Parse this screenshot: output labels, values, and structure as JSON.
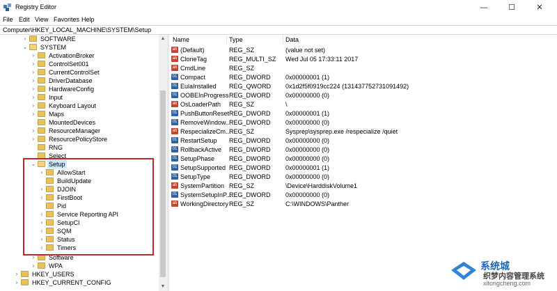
{
  "window": {
    "title": "Registry Editor",
    "controls": {
      "minimize": "—",
      "maximize": "☐",
      "close": "✕"
    }
  },
  "menu": [
    "File",
    "Edit",
    "View",
    "Favorites",
    "Help"
  ],
  "address": "Computer\\HKEY_LOCAL_MACHINE\\SYSTEM\\Setup",
  "tree": [
    {
      "label": "SOFTWARE",
      "expander": "›"
    },
    {
      "label": "SYSTEM",
      "expander": "⌄"
    },
    {
      "label": "ActivationBroker",
      "expander": "›"
    },
    {
      "label": "ControlSet001",
      "expander": "›"
    },
    {
      "label": "CurrentControlSet",
      "expander": "›"
    },
    {
      "label": "DriverDatabase",
      "expander": "›"
    },
    {
      "label": "HardwareConfig",
      "expander": "›"
    },
    {
      "label": "Input",
      "expander": "›"
    },
    {
      "label": "Keyboard Layout",
      "expander": "›"
    },
    {
      "label": "Maps",
      "expander": "›"
    },
    {
      "label": "MountedDevices",
      "expander": ""
    },
    {
      "label": "ResourceManager",
      "expander": "›"
    },
    {
      "label": "ResourcePolicyStore",
      "expander": "›"
    },
    {
      "label": "RNG",
      "expander": ""
    },
    {
      "label": "Select",
      "expander": ""
    },
    {
      "label": "Setup",
      "expander": "⌄"
    },
    {
      "label": "AllowStart",
      "expander": "›"
    },
    {
      "label": "BuildUpdate",
      "expander": ""
    },
    {
      "label": "DJOIN",
      "expander": "›"
    },
    {
      "label": "FirstBoot",
      "expander": "›"
    },
    {
      "label": "Pid",
      "expander": ""
    },
    {
      "label": "Service Reporting API",
      "expander": "›"
    },
    {
      "label": "SetupCI",
      "expander": "›"
    },
    {
      "label": "SQM",
      "expander": "›"
    },
    {
      "label": "Status",
      "expander": "›"
    },
    {
      "label": "Timers",
      "expander": "›"
    },
    {
      "label": "Software",
      "expander": "›"
    },
    {
      "label": "WPA",
      "expander": "›"
    },
    {
      "label": "HKEY_USERS",
      "expander": "›"
    },
    {
      "label": "HKEY_CURRENT_CONFIG",
      "expander": "›"
    }
  ],
  "selected_key": "Setup",
  "columns": {
    "name": "Name",
    "type": "Type",
    "data": "Data"
  },
  "values": [
    {
      "name": "(Default)",
      "type": "REG_SZ",
      "data": "(value not set)",
      "icon": "ab"
    },
    {
      "name": "CloneTag",
      "type": "REG_MULTI_SZ",
      "data": "Wed Jul 05 17:33:11 2017",
      "icon": "ab"
    },
    {
      "name": "CmdLine",
      "type": "REG_SZ",
      "data": "",
      "icon": "ab"
    },
    {
      "name": "Compact",
      "type": "REG_DWORD",
      "data": "0x00000001 (1)",
      "icon": "bin"
    },
    {
      "name": "EulaInstalled",
      "type": "REG_QWORD",
      "data": "0x1d2f5f0919cc224 (131437752731091492)",
      "icon": "bin"
    },
    {
      "name": "OOBEInProgress",
      "type": "REG_DWORD",
      "data": "0x00000000 (0)",
      "icon": "bin"
    },
    {
      "name": "OsLoaderPath",
      "type": "REG_SZ",
      "data": "\\",
      "icon": "ab"
    },
    {
      "name": "PushButtonReset",
      "type": "REG_DWORD",
      "data": "0x00000001 (1)",
      "icon": "bin"
    },
    {
      "name": "RemoveWindow...",
      "type": "REG_DWORD",
      "data": "0x00000000 (0)",
      "icon": "bin"
    },
    {
      "name": "RespecializeCm...",
      "type": "REG_SZ",
      "data": "Sysprep\\sysprep.exe /respecialize /quiet",
      "icon": "ab"
    },
    {
      "name": "RestartSetup",
      "type": "REG_DWORD",
      "data": "0x00000000 (0)",
      "icon": "bin"
    },
    {
      "name": "RollbackActive",
      "type": "REG_DWORD",
      "data": "0x00000000 (0)",
      "icon": "bin"
    },
    {
      "name": "SetupPhase",
      "type": "REG_DWORD",
      "data": "0x00000000 (0)",
      "icon": "bin"
    },
    {
      "name": "SetupSupported",
      "type": "REG_DWORD",
      "data": "0x00000001 (1)",
      "icon": "bin"
    },
    {
      "name": "SetupType",
      "type": "REG_DWORD",
      "data": "0x00000000 (0)",
      "icon": "bin"
    },
    {
      "name": "SystemPartition",
      "type": "REG_SZ",
      "data": "\\Device\\HarddiskVolume1",
      "icon": "ab"
    },
    {
      "name": "SystemSetupInP...",
      "type": "REG_DWORD",
      "data": "0x00000000 (0)",
      "icon": "bin"
    },
    {
      "name": "WorkingDirectory",
      "type": "REG_SZ",
      "data": "C:\\WINDOWS\\Panther",
      "icon": "ab"
    }
  ],
  "watermark": {
    "line1": "系统城",
    "line2": "织梦内容管理系统",
    "line3": "xitongcheng.com"
  },
  "colors": {
    "highlight_box": "#c0262d",
    "selection": "#cce8ff",
    "folder": "#e8c25c"
  }
}
